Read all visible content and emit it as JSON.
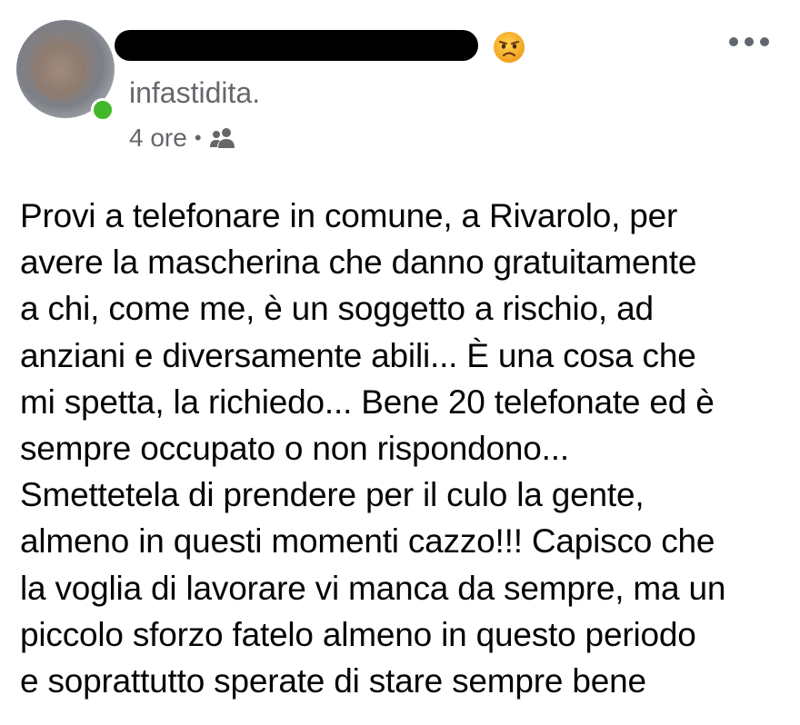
{
  "post": {
    "feeling": "infastidita.",
    "timestamp": "4 ore",
    "separator": "•",
    "audience_icon": "friends-icon",
    "emoji_icon": "annoyed-face-emoji",
    "menu_icon": "more-options-icon",
    "body": "Provi a telefonare in comune, a Rivarolo, per\navere la mascherina che danno gratuitamente\na chi, come me, è un soggetto a rischio, ad\nanziani e diversamente abili... È una cosa che\nmi spetta, la richiedo... Bene 20 telefonate ed è\nsempre occupato o non rispondono...\nSmettetela di prendere per il culo la gente,\nalmeno in questi momenti cazzo!!! Capisco che\nla voglia di lavorare vi manca da sempre, ma un\npiccolo sforzo fatelo almeno in questo periodo\ne soprattutto sperate di stare sempre bene"
  },
  "colors": {
    "secondary_text": "#65676b",
    "primary_text": "#050505",
    "online": "#42b72a",
    "emoji": "#f7b125"
  }
}
